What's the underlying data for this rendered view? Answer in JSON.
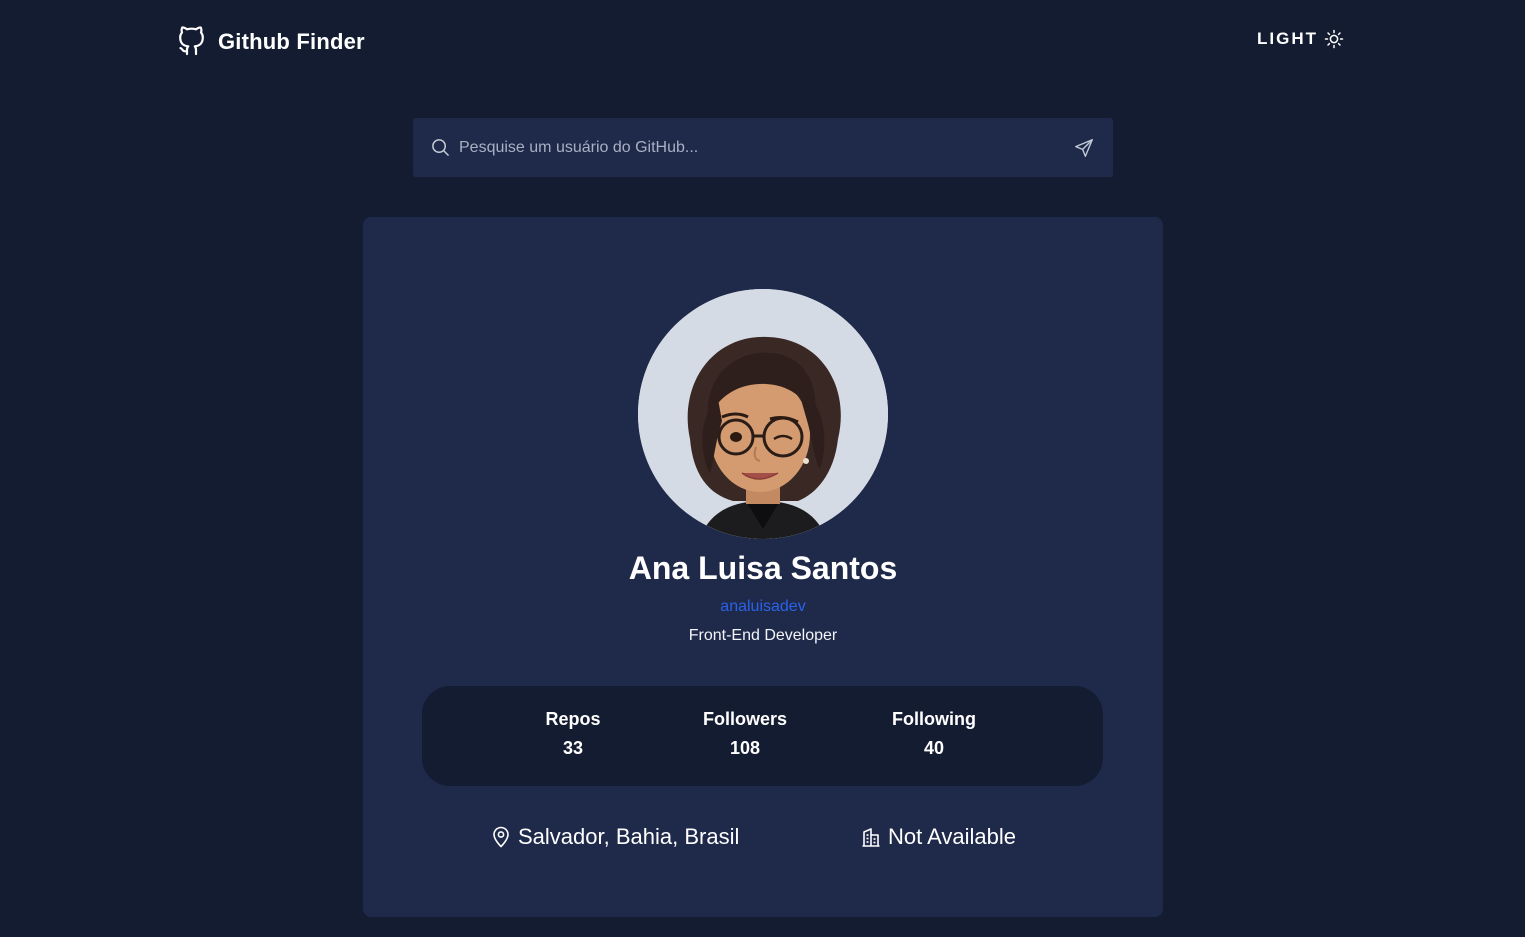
{
  "header": {
    "brand_title": "Github Finder",
    "logo_icon": "github-cat-icon",
    "theme_toggle_label": "LIGHT",
    "theme_icon": "sun-icon"
  },
  "search": {
    "placeholder": "Pesquise um usuário do GitHub...",
    "value": "",
    "search_icon": "search-icon",
    "submit_icon": "send-icon"
  },
  "profile": {
    "name": "Ana Luisa Santos",
    "login": "analuisadev",
    "bio": "Front-End Developer",
    "stats": [
      {
        "label": "Repos",
        "value": "33"
      },
      {
        "label": "Followers",
        "value": "108"
      },
      {
        "label": "Following",
        "value": "40"
      }
    ],
    "location": "Salvador, Bahia, Brasil",
    "company": "Not Available"
  },
  "colors": {
    "background": "#141c31",
    "surface": "#1f2a4a",
    "link": "#2a62e8",
    "text": "#ffffff"
  }
}
